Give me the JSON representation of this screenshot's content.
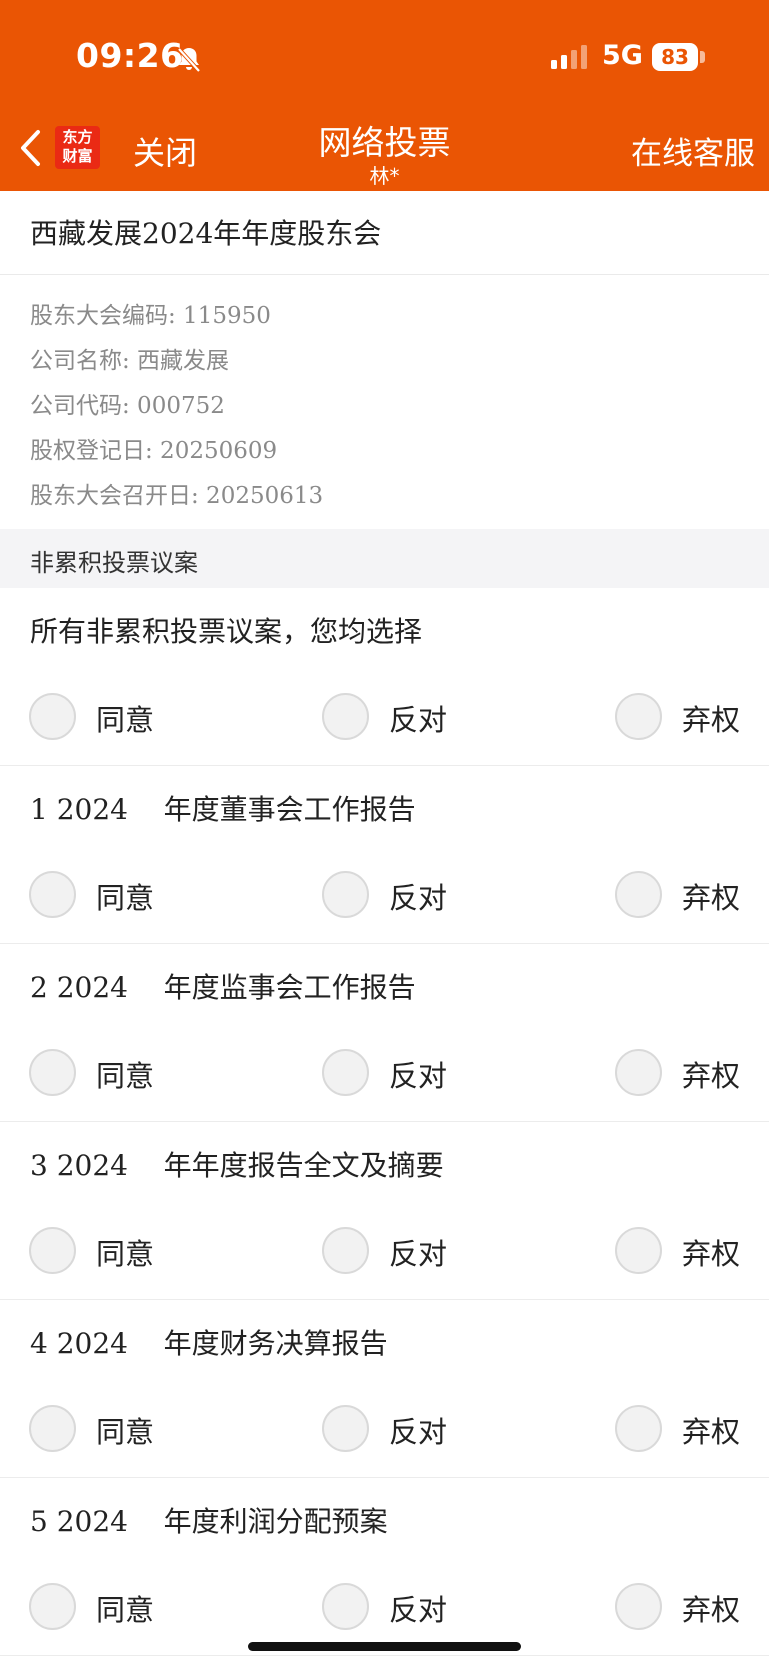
{
  "status": {
    "time": "09:26",
    "network": "5G",
    "battery": "83"
  },
  "nav": {
    "logo_line1": "东方",
    "logo_line2": "财富",
    "close_label": "关闭",
    "title": "网络投票",
    "subtitle": "林*",
    "service_label": "在线客服"
  },
  "meeting": {
    "title": "西藏发展2024年年度股东会",
    "info": [
      "股东大会编码: 115950",
      "公司名称: 西藏发展",
      "公司代码: 000752",
      "股权登记日: 20250609",
      "股东大会召开日: 20250613"
    ]
  },
  "section": {
    "title": "非累积投票议案"
  },
  "options": {
    "agree": "同意",
    "oppose": "反对",
    "abstain": "弃权"
  },
  "proposals": [
    {
      "title": "所有非累积投票议案，您均选择"
    },
    {
      "title": "1 2024    年度董事会工作报告"
    },
    {
      "title": "2 2024    年度监事会工作报告"
    },
    {
      "title": "3 2024    年年度报告全文及摘要"
    },
    {
      "title": "4 2024    年度财务决算报告"
    },
    {
      "title": "5 2024    年度利润分配预案"
    }
  ],
  "colors": {
    "brand": "#ea5504",
    "logo_red": "#ea2a14"
  },
  "icons": [
    "back-icon",
    "bell-slash-icon",
    "signal-icon"
  ]
}
